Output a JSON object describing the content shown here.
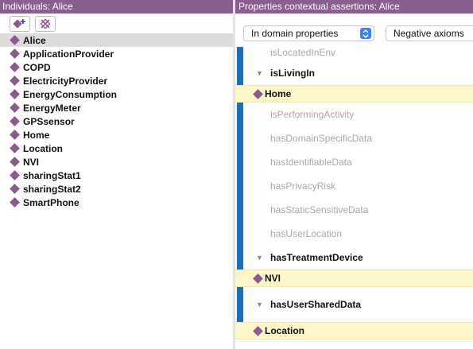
{
  "left_panel": {
    "header": "Individuals: Alice",
    "add_icon": "add-individual-icon",
    "delete_icon": "delete-individual-icon",
    "individuals": [
      {
        "label": "Alice",
        "selected": true
      },
      {
        "label": "ApplicationProvider"
      },
      {
        "label": "COPD"
      },
      {
        "label": "ElectricityProvider"
      },
      {
        "label": "EnergyConsumption"
      },
      {
        "label": "EnergyMeter"
      },
      {
        "label": "GPSsensor"
      },
      {
        "label": "Home"
      },
      {
        "label": "Location"
      },
      {
        "label": "NVI"
      },
      {
        "label": "sharingStat1"
      },
      {
        "label": "sharingStat2"
      },
      {
        "label": "SmartPhone"
      }
    ]
  },
  "right_panel": {
    "header": "Properties contextual assertions: Alice",
    "filter_select": {
      "selected": "In domain properties"
    },
    "negative_button": "Negative axioms",
    "rows": [
      {
        "kind": "partial",
        "label": "isLocatedInEnv",
        "bar": true
      },
      {
        "kind": "expanded",
        "label": "isLivingIn",
        "bar": true
      },
      {
        "kind": "individual",
        "label": "Home"
      },
      {
        "kind": "property",
        "label": "isPerformingActivity",
        "bar": true
      },
      {
        "kind": "property",
        "label": "hasDomainSpecificData",
        "bar": true
      },
      {
        "kind": "property",
        "label": "hasIdentifiableData",
        "bar": true
      },
      {
        "kind": "property",
        "label": "hasPrivacyRisk",
        "bar": true
      },
      {
        "kind": "property",
        "label": "hasStaticSensitiveData",
        "bar": true
      },
      {
        "kind": "property",
        "label": "hasUserLocation",
        "bar": true
      },
      {
        "kind": "expanded",
        "label": "hasTreatmentDevice",
        "bar": true
      },
      {
        "kind": "individual",
        "label": "NVI"
      },
      {
        "kind": "gap",
        "bar": true
      },
      {
        "kind": "expanded",
        "label": "hasUserSharedData",
        "bar": true
      },
      {
        "kind": "gap",
        "bar": true
      },
      {
        "kind": "individual",
        "label": "Location"
      }
    ]
  },
  "colors": {
    "header_bg": "#8a5e8f",
    "diamond": "#8e5a8e",
    "selected_row": "#dcdcdc",
    "property_bar": "#1570b8",
    "individual_row_bg": "#fdf6c9",
    "muted_text": "#a8a8a8"
  }
}
